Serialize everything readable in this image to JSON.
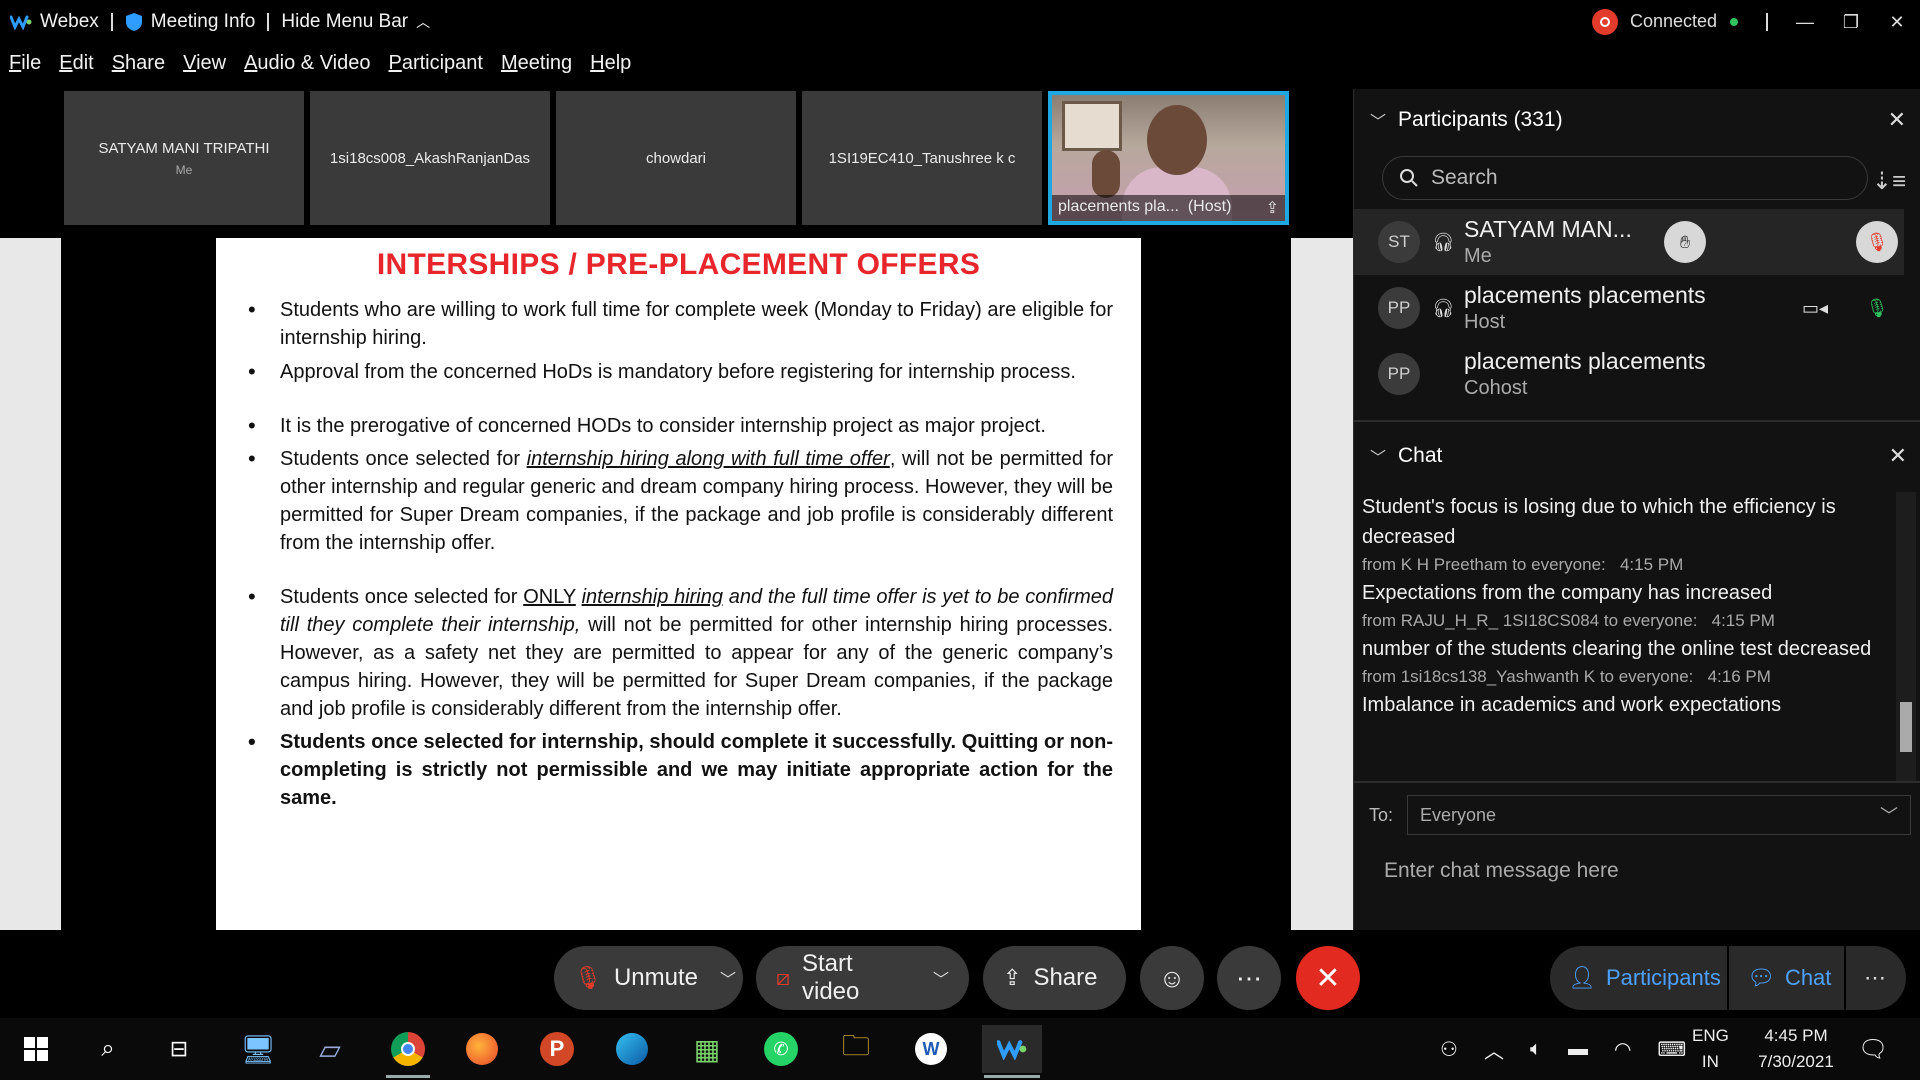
{
  "titlebar": {
    "app": "Webex",
    "meeting_info": "Meeting Info",
    "hide_menu": "Hide Menu Bar",
    "connected": "Connected"
  },
  "menu": [
    "File",
    "Edit",
    "Share",
    "View",
    "Audio & Video",
    "Participant",
    "Meeting",
    "Help"
  ],
  "strip": {
    "tiles": [
      {
        "name": "SATYAM MANI TRIPATHI",
        "sub": "Me"
      },
      {
        "name": "1si18cs008_AkashRanjanDas",
        "sub": ""
      },
      {
        "name": "chowdari",
        "sub": ""
      },
      {
        "name": "1SI19EC410_Tanushree k c",
        "sub": ""
      }
    ],
    "active": {
      "name": "placements pla...",
      "role": "(Host)"
    }
  },
  "slide": {
    "title": "INTERSHIPS / PRE-PLACEMENT OFFERS",
    "b1": "Students who are willing to work full time for complete week (Monday to Friday) are eligible for internship hiring.",
    "b2": "Approval from the concerned HoDs is mandatory before registering for internship process.",
    "b3": "It is the prerogative of concerned HODs to consider internship project as major project.",
    "b4_pre": "Students once selected for ",
    "b4_u": "internship hiring along with full time offer",
    "b4_post": ", will not be permitted for other internship and regular generic and dream company hiring process. However, they will be permitted for Super Dream companies, if the package and job profile is considerably different from the internship offer.",
    "b5_pre": "Students once selected for ",
    "b5_only": "ONLY",
    "b5_u": "internship hiring",
    "b5_it": " and the full time offer is yet to be confirmed till they complete their internship,",
    "b5_post": " will not be permitted for other internship hiring processes. However, as a safety net they are permitted to appear for any of the generic company’s campus hiring.  However, they will be permitted for Super Dream companies, if the package and job profile is considerably different from the internship offer.",
    "b6": "Students once selected for internship, should complete it successfully. Quitting or non-completing is strictly not permissible and we may initiate appropriate action for the same."
  },
  "participants": {
    "header": "Participants (331)",
    "search_placeholder": "Search",
    "list": [
      {
        "initials": "ST",
        "name": "SATYAM MAN...",
        "role": "Me"
      },
      {
        "initials": "PP",
        "name": "placements placements",
        "role": "Host"
      },
      {
        "initials": "PP",
        "name": "placements placements",
        "role": "Cohost"
      }
    ]
  },
  "chat": {
    "header": "Chat",
    "messages": [
      {
        "text": "Student's focus is losing due to which the efficiency is decreased"
      },
      {
        "meta": "from K H Preetham to everyone:",
        "time": "4:15 PM",
        "text": "Expectations from the company has increased"
      },
      {
        "meta": "from RAJU_H_R_ 1SI18CS084 to everyone:",
        "time": "4:15 PM",
        "text": "number of the students clearing the online test decreased"
      },
      {
        "meta": "from 1si18cs138_Yashwanth K to everyone:",
        "time": "4:16 PM",
        "text": "Imbalance in academics and work expectations"
      }
    ],
    "to_label": "To:",
    "to_value": "Everyone",
    "input_placeholder": "Enter chat message here"
  },
  "controls": {
    "unmute": "Unmute",
    "start_video": "Start video",
    "share": "Share",
    "participants": "Participants",
    "chat": "Chat"
  },
  "taskbar": {
    "lang1": "ENG",
    "lang2": "IN",
    "time": "4:45 PM",
    "date": "7/30/2021"
  },
  "colors": {
    "accent": "#1ea7e1",
    "slide_title": "#e8252a",
    "leave": "#e22a20",
    "link_blue": "#4da0ff"
  }
}
